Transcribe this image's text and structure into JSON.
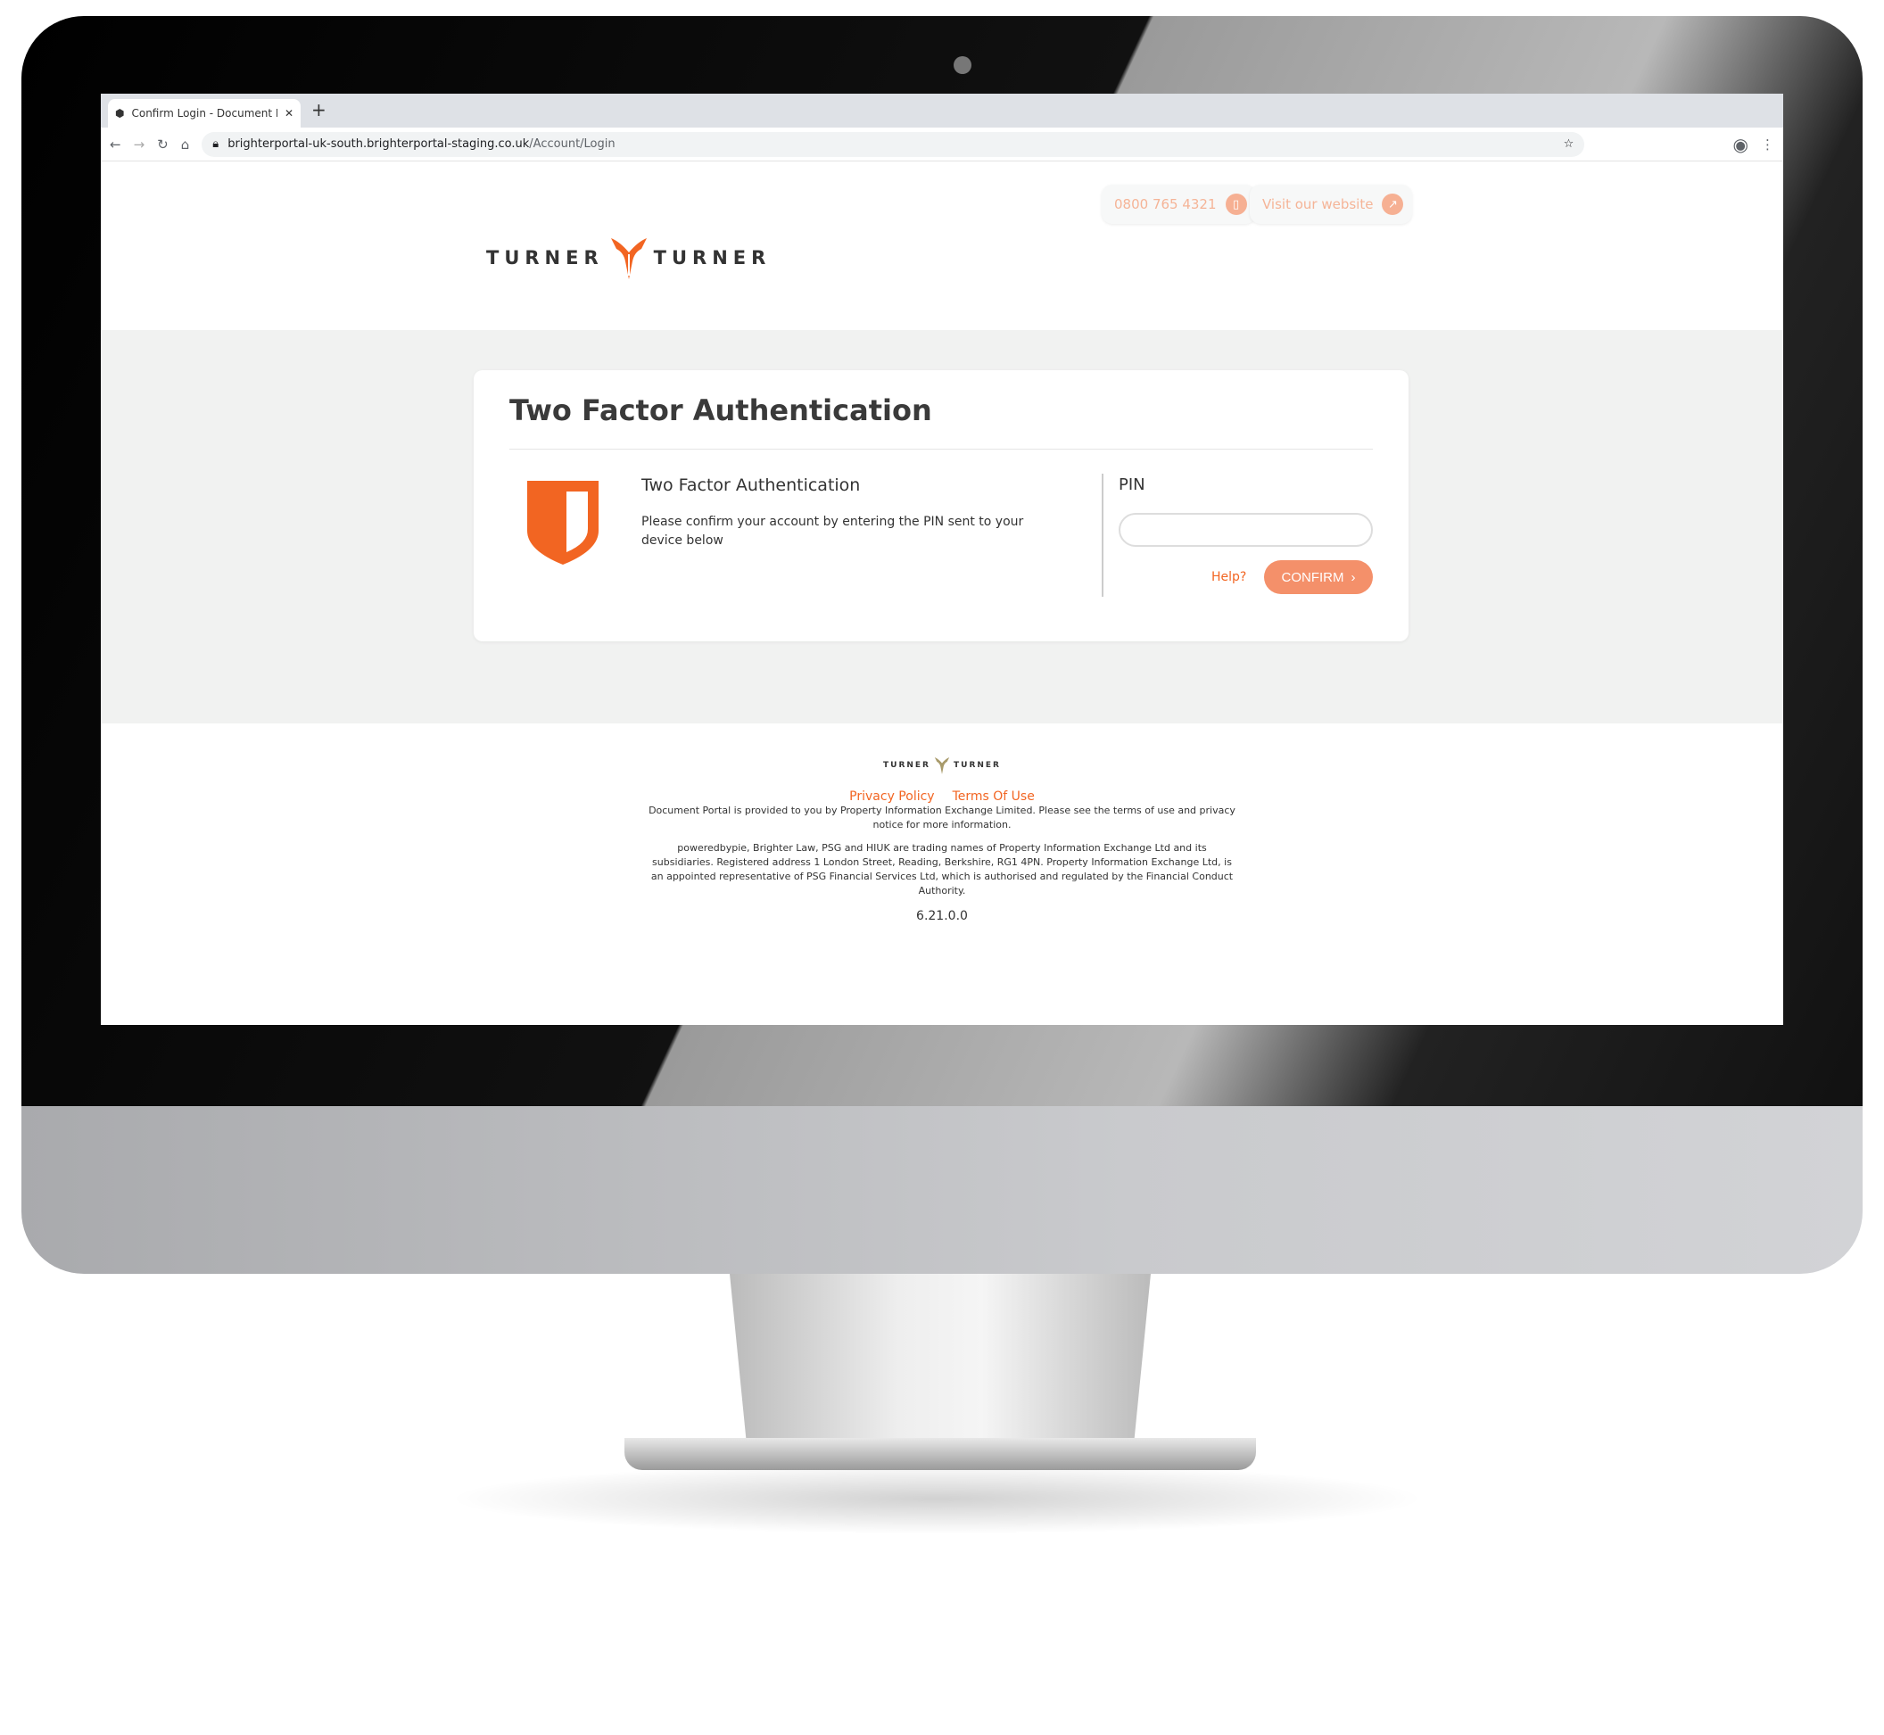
{
  "browser": {
    "tab_title": "Confirm Login - Document Portal",
    "url_host": "brighterportal-uk-south.brighterportal-staging.co.uk",
    "url_path": "/Account/Login"
  },
  "header": {
    "logo_left": "TURNER",
    "logo_right": "TURNER",
    "phone": "0800 765 4321",
    "website": "Visit our website"
  },
  "card": {
    "title": "Two Factor Authentication",
    "subtitle": "Two Factor Authentication",
    "description": "Please confirm your account by entering the PIN sent to your device below",
    "pin_label": "PIN",
    "pin_value": "",
    "help": "Help?",
    "confirm": "CONFIRM"
  },
  "footer": {
    "privacy": "Privacy Policy",
    "terms": "Terms Of Use",
    "line1": "Document Portal is provided to you by Property Information Exchange Limited. Please see the terms of use and privacy notice for more information.",
    "line2": "poweredbypie, Brighter Law, PSG and HIUK are trading names of Property Information Exchange Ltd and its subsidiaries. Registered address 1 London Street, Reading, Berkshire, RG1 4PN. Property Information Exchange Ltd, is an appointed representative of PSG Financial Services Ltd, which is authorised and regulated by the Financial Conduct Authority.",
    "version": "6.21.0.0"
  },
  "colors": {
    "accent": "#f26522",
    "button": "#f4906a",
    "band": "#f1f2f1"
  }
}
